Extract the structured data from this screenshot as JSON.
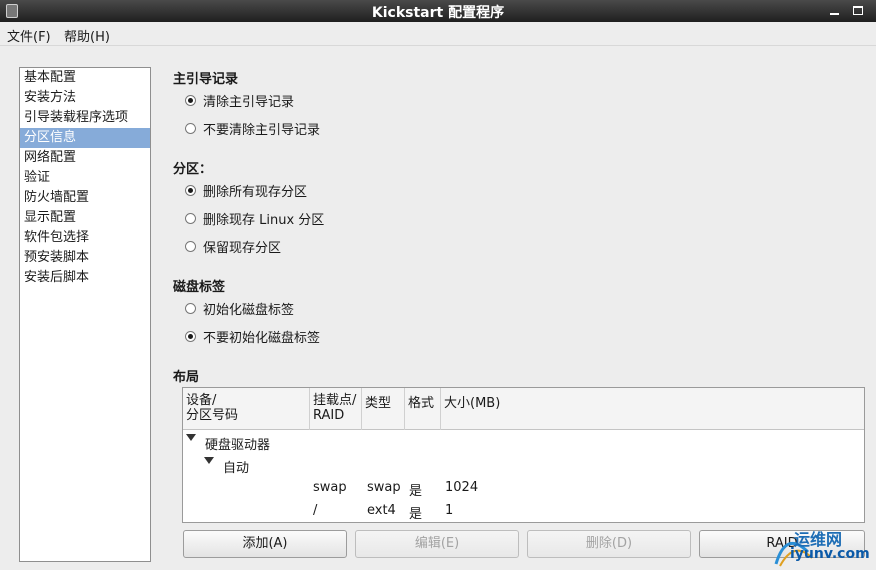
{
  "window": {
    "title": "Kickstart 配置程序"
  },
  "menu": {
    "file": "文件(F)",
    "help": "帮助(H)"
  },
  "sidebar": {
    "items": [
      "基本配置",
      "安装方法",
      "引导装载程序选项",
      "分区信息",
      "网络配置",
      "验证",
      "防火墙配置",
      "显示配置",
      "软件包选择",
      "预安装脚本",
      "安装后脚本"
    ],
    "selected": "分区信息"
  },
  "mbr": {
    "title": "主引导记录",
    "options": [
      "清除主引导记录",
      "不要清除主引导记录"
    ],
    "selected": "清除主引导记录"
  },
  "partitions": {
    "title": "分区：",
    "options": [
      "删除所有现存分区",
      "删除现存 Linux 分区",
      "保留现存分区"
    ],
    "selected": "删除所有现存分区"
  },
  "disklabel": {
    "title": "磁盘标签",
    "options": [
      "初始化磁盘标签",
      "不要初始化磁盘标签"
    ],
    "selected": "不要初始化磁盘标签"
  },
  "layout": {
    "title": "布局",
    "columns": {
      "device_line1": "设备/",
      "device_line2": "分区号码",
      "mount_line1": "挂载点/",
      "mount_line2": "RAID",
      "type": "类型",
      "format": "格式",
      "size": "大小(MB)"
    },
    "tree": {
      "root": "硬盘驱动器",
      "child": "自动",
      "rows": [
        {
          "mount": "swap",
          "type": "swap",
          "format": "是",
          "size": "1024"
        },
        {
          "mount": "/",
          "type": "ext4",
          "format": "是",
          "size": "1"
        }
      ]
    }
  },
  "buttons": {
    "add": "添加(A)",
    "edit": "编辑(E)",
    "delete": "删除(D)",
    "raid": "RAID"
  },
  "watermark": {
    "cn": "运维网",
    "url": "iyunv.com"
  }
}
